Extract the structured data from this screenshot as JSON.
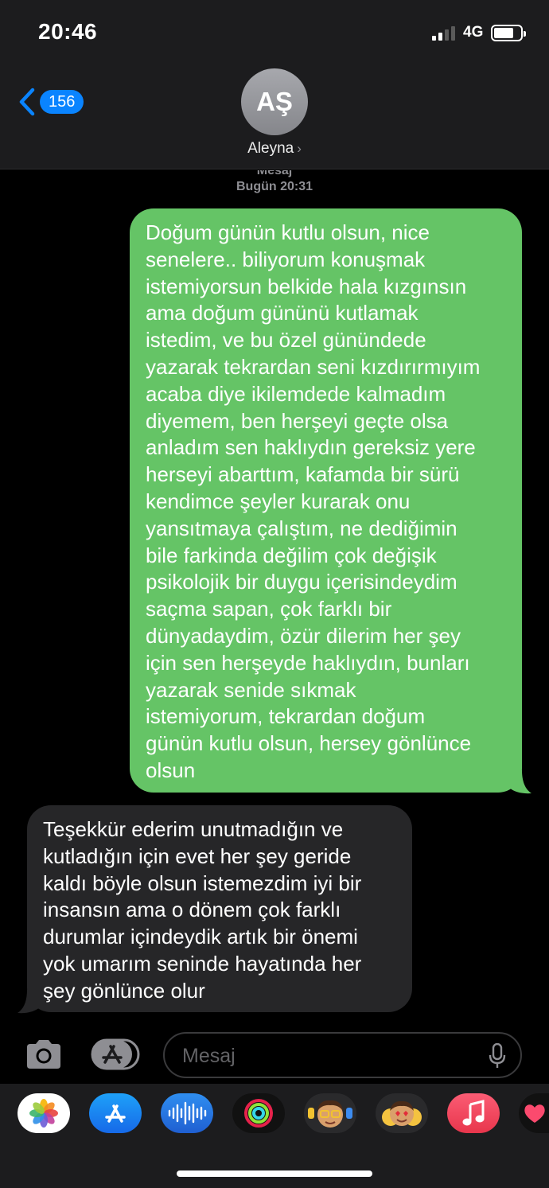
{
  "status_bar": {
    "time": "20:46",
    "network": "4G",
    "signal_bars_active": 2,
    "signal_bars_total": 4,
    "battery_level": 0.75
  },
  "header": {
    "back_count": "156",
    "avatar_initials": "AŞ",
    "contact_name": "Aleyna"
  },
  "thread": {
    "service": "Mesaj",
    "timestamp": "Bugün 20:31",
    "messages": [
      {
        "direction": "sent",
        "text": "Doğum günün kutlu olsun, nice\nsenelere.. biliyorum konuşmak\nistemiyorsun belkide hala kızgınsın\nama doğum gününü kutlamak\nistedim, ve bu özel günündede\nyazarak tekrardan seni kızdırırmıyım\nacaba diye ikilemdede kalmadım\ndiyemem, ben herşeyi geçte olsa\nanladım sen haklıydın gereksiz yere\nherseyi abarttım, kafamda bir sürü\nkendimce şeyler kurarak onu\nyansıtmaya çalıştım, ne dediğimin\nbile farkinda değilim çok değişik\npsikolojik bir duygu içerisindeydim\nsaçma sapan, çok farklı bir\ndünyadaydim, özür dilerim her şey\niçin sen herşeyde haklıydın, bunları\nyazarak senide sıkmak\nistemiyorum, tekrardan doğum\ngünün kutlu olsun, hersey gönlünce\nolsun"
      },
      {
        "direction": "received",
        "text": "Teşekkür ederim unutmadığın ve\nkutladığın için evet her şey geride\nkaldı böyle olsun istemezdim iyi bir\ninsansın ama o dönem çok farklı\ndurumlar içindeydik artık bir önemi\nyok umarım seninde hayatında her\nşey gönlünce olur"
      }
    ]
  },
  "composer": {
    "placeholder": "Mesaj"
  },
  "colors": {
    "sent_bubble": "#65c466",
    "received_bubble": "#262628",
    "accent": "#0a84ff",
    "header_bg": "#1c1c1e"
  },
  "app_drawer": [
    {
      "name": "photos-icon"
    },
    {
      "name": "app-store-icon"
    },
    {
      "name": "audio-message-icon"
    },
    {
      "name": "activity-icon"
    },
    {
      "name": "memoji-icon"
    },
    {
      "name": "memoji-stickers-icon"
    },
    {
      "name": "music-icon"
    },
    {
      "name": "digital-touch-icon"
    }
  ]
}
